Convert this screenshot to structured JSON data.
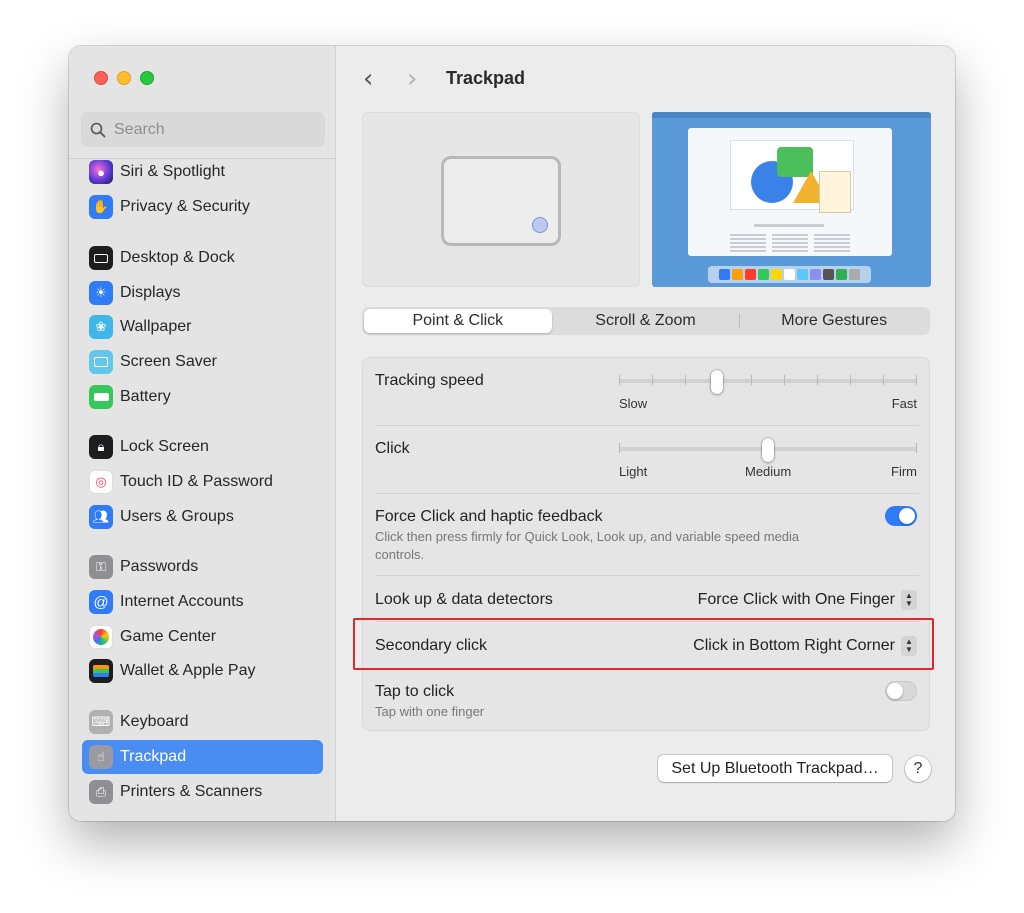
{
  "sidebar": {
    "search_placeholder": "Search",
    "items": [
      {
        "label": "Siri & Spotlight",
        "icon": "siri-icon",
        "color": "#6a3fd6"
      },
      {
        "label": "Privacy & Security",
        "icon": "hand-icon",
        "color": "#2f7cf6"
      },
      {
        "label": "Desktop & Dock",
        "icon": "dock-icon",
        "color": "#1d1d1f"
      },
      {
        "label": "Displays",
        "icon": "sun-icon",
        "color": "#2f7cf6"
      },
      {
        "label": "Wallpaper",
        "icon": "flower-icon",
        "color": "#3fb6e8"
      },
      {
        "label": "Screen Saver",
        "icon": "screen-saver-icon",
        "color": "#5ec4e8"
      },
      {
        "label": "Battery",
        "icon": "battery-icon",
        "color": "#34c759"
      },
      {
        "label": "Lock Screen",
        "icon": "lock-icon",
        "color": "#1d1d1f"
      },
      {
        "label": "Touch ID & Password",
        "icon": "fingerprint-icon",
        "color": "#ffffff"
      },
      {
        "label": "Users & Groups",
        "icon": "users-icon",
        "color": "#2f7cf6"
      },
      {
        "label": "Passwords",
        "icon": "key-icon",
        "color": "#8e8e93"
      },
      {
        "label": "Internet Accounts",
        "icon": "at-icon",
        "color": "#2f7cf6"
      },
      {
        "label": "Game Center",
        "icon": "game-center-icon",
        "color": "#ffffff"
      },
      {
        "label": "Wallet & Apple Pay",
        "icon": "wallet-icon",
        "color": "#1d1d1f"
      },
      {
        "label": "Keyboard",
        "icon": "keyboard-icon",
        "color": "#a0a0a0"
      },
      {
        "label": "Trackpad",
        "icon": "trackpad-icon",
        "color": "#8e8e93"
      },
      {
        "label": "Printers & Scanners",
        "icon": "printer-icon",
        "color": "#8e8e93"
      }
    ],
    "selected": "Trackpad"
  },
  "header": {
    "title": "Trackpad"
  },
  "tabs": [
    "Point & Click",
    "Scroll & Zoom",
    "More Gestures"
  ],
  "active_tab": "Point & Click",
  "settings": {
    "tracking_speed": {
      "label": "Tracking speed",
      "min_label": "Slow",
      "max_label": "Fast",
      "value_fraction": 0.33
    },
    "click": {
      "label": "Click",
      "min_label": "Light",
      "mid_label": "Medium",
      "max_label": "Firm",
      "value_fraction": 0.5
    },
    "force_click": {
      "label": "Force Click and haptic feedback",
      "description": "Click then press firmly for Quick Look, Look up, and variable speed media controls.",
      "enabled": true
    },
    "look_up": {
      "label": "Look up & data detectors",
      "value": "Force Click with One Finger"
    },
    "secondary_click": {
      "label": "Secondary click",
      "value": "Click in Bottom Right Corner"
    },
    "tap_to_click": {
      "label": "Tap to click",
      "description": "Tap with one finger",
      "enabled": false
    }
  },
  "buttons": {
    "bluetooth": "Set Up Bluetooth Trackpad…",
    "help": "?"
  },
  "colors": {
    "accent": "#2f7cf6",
    "highlight_box": "#e1262c",
    "selected_sidebar": "#4a8df2"
  }
}
